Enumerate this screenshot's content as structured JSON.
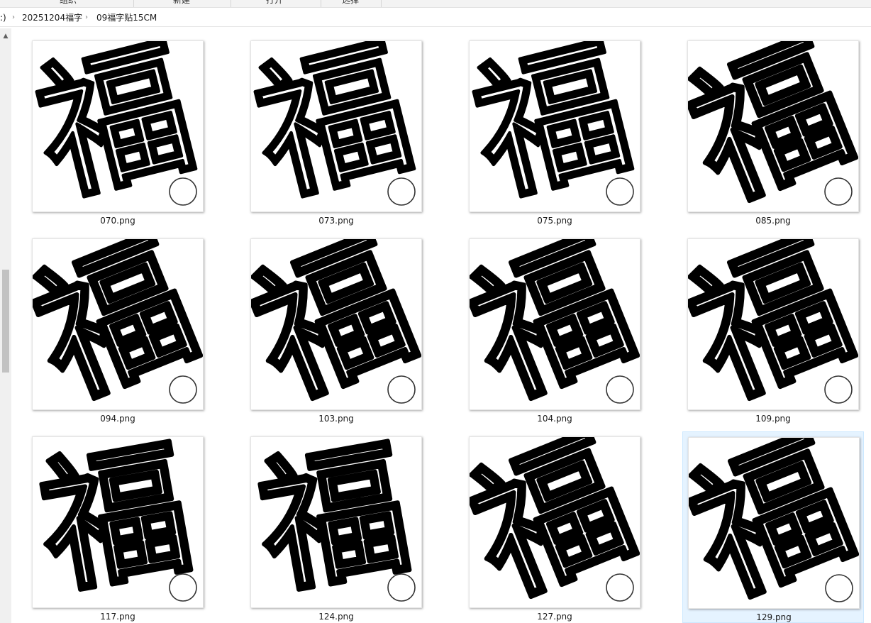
{
  "ribbon": {
    "tabs": [
      "组织",
      "新建",
      "打开",
      "选择"
    ]
  },
  "address": {
    "drive_fragment": ":)",
    "segments": [
      "20251204福字",
      "09福字贴15CM"
    ]
  },
  "files": [
    {
      "name": "070.png",
      "variant": 1,
      "selected": false
    },
    {
      "name": "073.png",
      "variant": 1,
      "selected": false
    },
    {
      "name": "075.png",
      "variant": 1,
      "selected": false
    },
    {
      "name": "085.png",
      "variant": 2,
      "selected": false
    },
    {
      "name": "094.png",
      "variant": 2,
      "selected": false
    },
    {
      "name": "103.png",
      "variant": 2,
      "selected": false
    },
    {
      "name": "104.png",
      "variant": 2,
      "selected": false
    },
    {
      "name": "109.png",
      "variant": 2,
      "selected": false
    },
    {
      "name": "117.png",
      "variant": 3,
      "selected": false
    },
    {
      "name": "124.png",
      "variant": 3,
      "selected": false
    },
    {
      "name": "127.png",
      "variant": 2,
      "selected": false
    },
    {
      "name": "129.png",
      "variant": 2,
      "selected": true
    }
  ],
  "thumbnail_glyph": "福",
  "colors": {
    "selection_bg": "#e5f3ff",
    "selection_border": "#cce8ff"
  }
}
